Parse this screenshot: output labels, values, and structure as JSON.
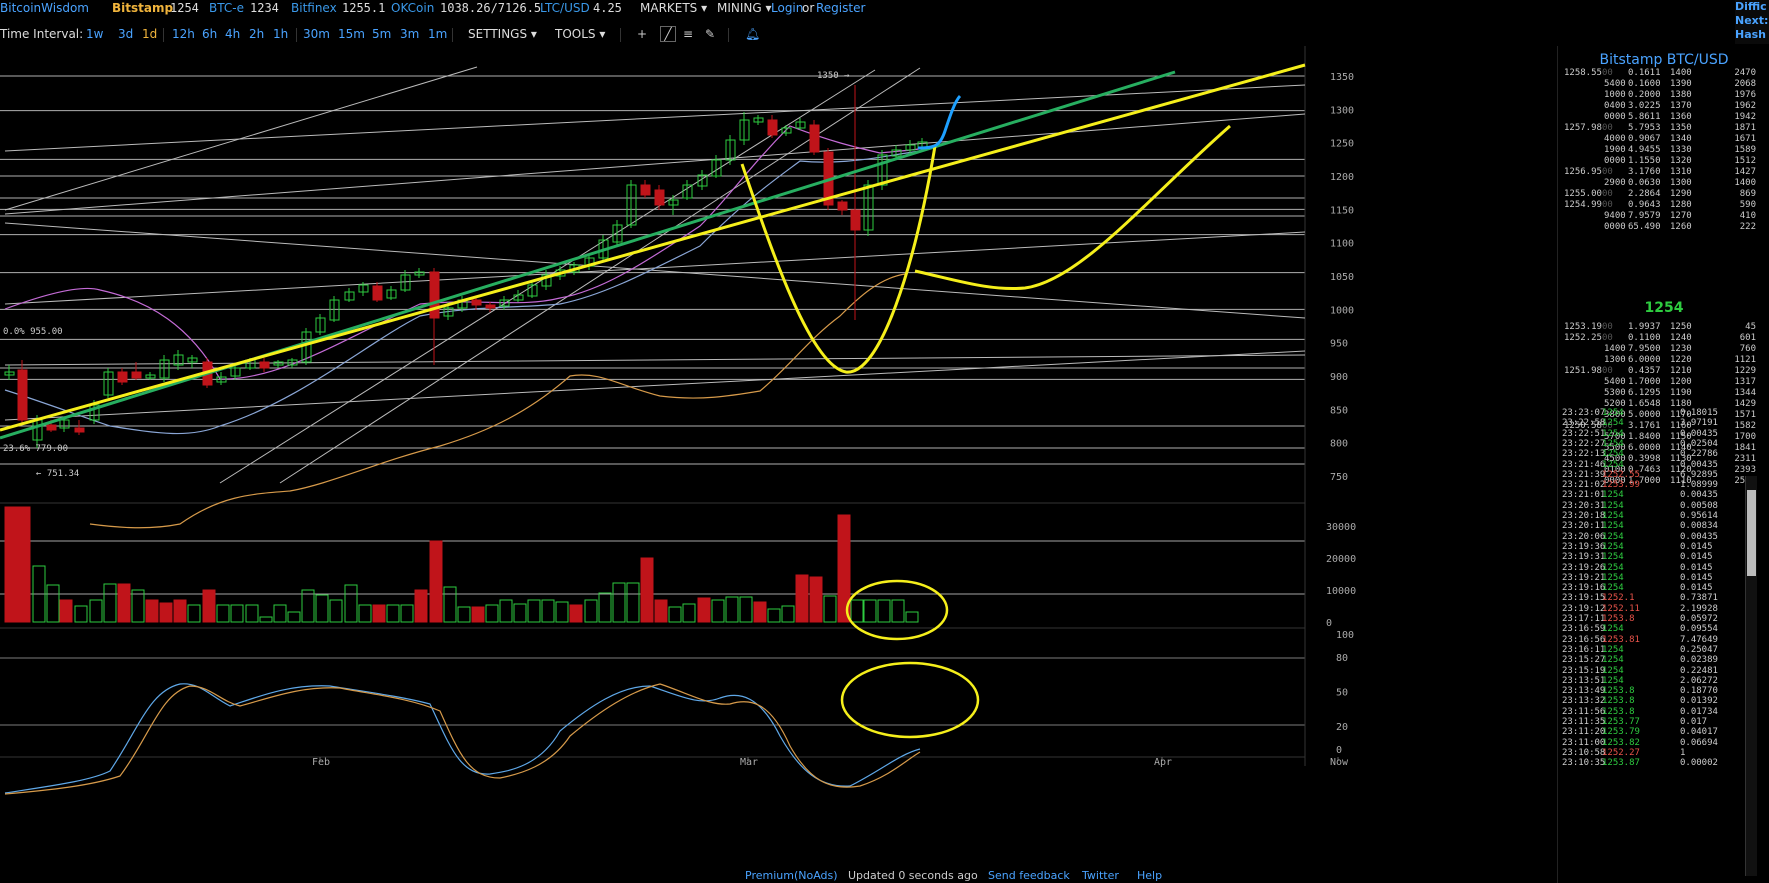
{
  "topbar": {
    "brand": "BitcoinWisdom",
    "items": [
      {
        "name": "Bitstamp",
        "value": "1254"
      },
      {
        "name": "BTC-e",
        "value": "1234"
      },
      {
        "name": "Bitfinex",
        "value": "1255.1"
      },
      {
        "name": "OKCoin",
        "value": "1038.26/7126.5"
      },
      {
        "name": "LTC/USD",
        "value": "4.25"
      }
    ],
    "markets": "MARKETS",
    "mining": "MINING",
    "login": "Login",
    "or": "or",
    "register": "Register",
    "diff": [
      "Diffic",
      "Next:",
      "Hash"
    ]
  },
  "toolbar": {
    "label": "Time Interval:",
    "intervals": [
      "1w",
      "3d",
      "1d",
      "12h",
      "6h",
      "4h",
      "2h",
      "1h",
      "30m",
      "15m",
      "5m",
      "3m",
      "1m"
    ],
    "active": "1d",
    "settings": "SETTINGS",
    "tools": "TOOLS"
  },
  "chart": {
    "price_ticks": [
      "1350",
      "1300",
      "1250",
      "1200",
      "1150",
      "1100",
      "1050",
      "1000",
      "950",
      "900",
      "850",
      "800",
      "750"
    ],
    "volume_ticks": [
      "30000",
      "20000",
      "10000",
      "0"
    ],
    "osc_ticks": [
      "100",
      "80",
      "50",
      "20",
      "0"
    ],
    "x_labels": [
      "Feb",
      "Mar",
      "Apr",
      "Now"
    ],
    "annotations": [
      "1350 →",
      "0.0% 955.00",
      "23.6% 779.00",
      "← 751.34"
    ]
  },
  "orderbook": {
    "title": "Bitstamp BTC/USD",
    "last": "1254",
    "asks": [
      [
        "1258.55",
        "00",
        "0.1611",
        "1400",
        "2470"
      ],
      [
        "",
        "5400",
        "0.1600",
        "1390",
        "2068"
      ],
      [
        "",
        "1000",
        "0.2000",
        "1380",
        "1976"
      ],
      [
        "",
        "0400",
        "3.0225",
        "1370",
        "1962"
      ],
      [
        "",
        "0000",
        "5.8611",
        "1360",
        "1942"
      ],
      [
        "1257.98",
        "00",
        "5.7953",
        "1350",
        "1871"
      ],
      [
        "",
        "4000",
        "0.9067",
        "1340",
        "1671"
      ],
      [
        "",
        "1900",
        "4.9455",
        "1330",
        "1589"
      ],
      [
        "",
        "0000",
        "1.1550",
        "1320",
        "1512"
      ],
      [
        "1256.95",
        "00",
        "3.1760",
        "1310",
        "1427"
      ],
      [
        "",
        "2900",
        "0.0630",
        "1300",
        "1400"
      ],
      [
        "1255.00",
        "00",
        "2.2864",
        "1290",
        "869"
      ],
      [
        "1254.99",
        "00",
        "0.9643",
        "1280",
        "590"
      ],
      [
        "",
        "9400",
        "7.9579",
        "1270",
        "410"
      ],
      [
        "",
        "0000",
        "65.490",
        "1260",
        "222"
      ]
    ],
    "bids": [
      [
        "1253.19",
        "00",
        "1.9937",
        "1250",
        "45"
      ],
      [
        "1252.25",
        "00",
        "0.1100",
        "1240",
        "601"
      ],
      [
        "",
        "1400",
        "7.9500",
        "1230",
        "760"
      ],
      [
        "",
        "1300",
        "6.0000",
        "1220",
        "1121"
      ],
      [
        "1251.98",
        "00",
        "0.4357",
        "1210",
        "1229"
      ],
      [
        "",
        "5400",
        "1.7000",
        "1200",
        "1317"
      ],
      [
        "",
        "5300",
        "6.1295",
        "1190",
        "1344"
      ],
      [
        "",
        "5200",
        "1.6548",
        "1180",
        "1429"
      ],
      [
        "",
        "3800",
        "5.0000",
        "1170",
        "1571"
      ],
      [
        "1250.58",
        "00",
        "3.1761",
        "1160",
        "1582"
      ],
      [
        "",
        "5700",
        "1.8400",
        "1150",
        "1700"
      ],
      [
        "",
        "5500",
        "6.0000",
        "1140",
        "1841"
      ],
      [
        "",
        "4500",
        "0.3998",
        "1130",
        "2311"
      ],
      [
        "",
        "0100",
        "0.7463",
        "1120",
        "2393"
      ],
      [
        "",
        "0000",
        "1.7000",
        "1110",
        "2526"
      ]
    ]
  },
  "trades": [
    [
      "23:23:07",
      "1254",
      "g",
      "0.18015"
    ],
    [
      "23:22:58",
      "1254",
      "g",
      "3.97191"
    ],
    [
      "23:22:51",
      "1254",
      "g",
      "0.00435"
    ],
    [
      "23:22:27",
      "1254",
      "g",
      "0.02504"
    ],
    [
      "23:22:13",
      "1254",
      "g",
      "0.22786"
    ],
    [
      "23:21:46",
      "1254",
      "g",
      "0.00435"
    ],
    [
      "23:21:39",
      "1252.55",
      "r",
      "6.92895"
    ],
    [
      "23:21:02",
      "1253.99",
      "r",
      "1.08999"
    ],
    [
      "23:21:01",
      "1254",
      "g",
      "0.00435"
    ],
    [
      "23:20:31",
      "1254",
      "g",
      "0.00508"
    ],
    [
      "23:20:18",
      "1254",
      "g",
      "0.95614"
    ],
    [
      "23:20:11",
      "1254",
      "g",
      "0.00834"
    ],
    [
      "23:20:06",
      "1254",
      "g",
      "0.00435"
    ],
    [
      "23:19:36",
      "1254",
      "g",
      "0.0145"
    ],
    [
      "23:19:31",
      "1254",
      "g",
      "0.0145"
    ],
    [
      "23:19:26",
      "1254",
      "g",
      "0.0145"
    ],
    [
      "23:19:21",
      "1254",
      "g",
      "0.0145"
    ],
    [
      "23:19:16",
      "1254",
      "g",
      "0.0145"
    ],
    [
      "23:19:15",
      "1252.1",
      "r",
      "0.73871"
    ],
    [
      "23:19:12",
      "1252.11",
      "r",
      "2.19928"
    ],
    [
      "23:17:11",
      "1253.8",
      "r",
      "0.05972"
    ],
    [
      "23:16:59",
      "1254",
      "g",
      "0.09554"
    ],
    [
      "23:16:56",
      "1253.81",
      "r",
      "7.47649"
    ],
    [
      "23:16:11",
      "1254",
      "g",
      "0.25047"
    ],
    [
      "23:15:27",
      "1254",
      "g",
      "0.02389"
    ],
    [
      "23:15:19",
      "1254",
      "g",
      "0.22481"
    ],
    [
      "23:13:51",
      "1254",
      "g",
      "2.06272"
    ],
    [
      "23:13:49",
      "1253.8",
      "g",
      "0.18770"
    ],
    [
      "23:13:32",
      "1253.8",
      "g",
      "0.01392"
    ],
    [
      "23:11:56",
      "1253.8",
      "g",
      "0.01734"
    ],
    [
      "23:11:35",
      "1253.77",
      "g",
      "0.017"
    ],
    [
      "23:11:20",
      "1253.79",
      "g",
      "0.04017"
    ],
    [
      "23:11:00",
      "1253.82",
      "g",
      "0.06694"
    ],
    [
      "23:10:58",
      "1252.27",
      "r",
      "1"
    ],
    [
      "23:10:35",
      "1253.87",
      "g",
      "0.00002"
    ]
  ],
  "footer": {
    "premium": "Premium(NoAds)",
    "updated": "Updated 0 seconds ago",
    "feedback": "Send feedback",
    "twitter": "Twitter",
    "help": "Help"
  },
  "colors": {
    "up": "#2ecc40",
    "down": "#c0141a",
    "accent": "#4aa3ff",
    "yellow": "#f5ef1b"
  }
}
